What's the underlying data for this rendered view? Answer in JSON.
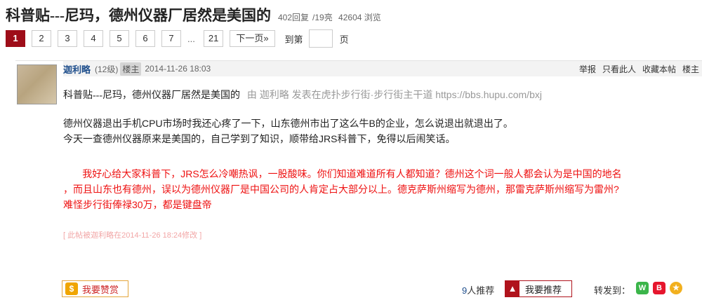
{
  "thread": {
    "title": "科普贴---尼玛，德州仪器厂居然是美国的",
    "replies": "402回复",
    "highlights": "/19亮",
    "views": "42604 浏览"
  },
  "pager": {
    "pages": [
      "1",
      "2",
      "3",
      "4",
      "5",
      "6",
      "7"
    ],
    "current": "1",
    "ellipsis": "...",
    "last_page": "21",
    "next_label": "下一页»",
    "jump_label": "到第",
    "jump_value": "",
    "jump_suffix": "页"
  },
  "post": {
    "author": "迦利略",
    "level": "(12级)",
    "op_badge": "楼主",
    "time": "2014-11-26 18:03",
    "actions": [
      "举报",
      "只看此人",
      "收藏本帖",
      "楼主"
    ],
    "quote_title": "科普贴---尼玛，德州仪器厂居然是美国的",
    "quote_source": "由 迦利略 发表在虎扑步行街·步行街主干道 https://bbs.hupu.com/bxj",
    "body_lines": [
      "德州仪器退出手机CPU市场时我还心疼了一下，山东德州市出了这么牛B的企业，怎么说退出就退出了。",
      "今天一查德州仪器原来是美国的，自己学到了知识，顺带给JRS科普下，免得以后闹笑话。"
    ],
    "red_lines": [
      "       我好心给大家科普下，JRS怎么冷嘲热讽，一股酸味。你们知道难道所有人都知道？德州这个词一般人都会认为是中国的地名",
      "，而且山东也有德州，误以为德州仪器厂是中国公司的人肯定占大部分以上。德克萨斯州缩写为德州，那雷克萨斯州缩写为雷州?",
      "难怪步行街俸禄30万，都是键盘帝"
    ],
    "edit_note": "[ 此帖被迦利略在2014-11-26 18:24修改 ]"
  },
  "bottom": {
    "reward_label": "我要赞赏",
    "rec_count": "9",
    "rec_suffix": "人推荐",
    "rec_label": "我要推荐",
    "share_label": "转发到："
  },
  "colors": {
    "accent": "#9e0d19",
    "author_link": "#1e4e8c",
    "red_text": "#ee1111"
  }
}
